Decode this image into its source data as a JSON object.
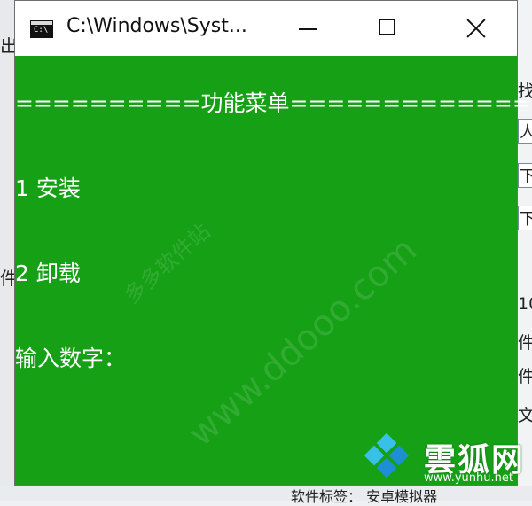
{
  "window": {
    "title": "C:\\Windows\\Syst..."
  },
  "console": {
    "header": "==========功能菜单=============",
    "option1": "1 安装",
    "option2": "2 卸载",
    "prompt": "输入数字："
  },
  "background": {
    "left_top": "出",
    "left_mid": "件",
    "right_1": "找",
    "right_2": "人",
    "right_3": "下",
    "right_4": "下",
    "right_5": "10",
    "right_6": "件",
    "right_7": "件",
    "right_8": "文",
    "bottom": "软件标签：  安卓模拟器"
  },
  "watermark": {
    "text": "www.ddooo.com",
    "text2": "多多软件站"
  },
  "logo": {
    "name": "雲狐网",
    "url": "www.yunhu.net"
  },
  "colors": {
    "console_bg": "#16a016",
    "text": "#ffffff",
    "logo_blue": "#1e8fd6",
    "logo_cyan": "#38c0e8"
  }
}
